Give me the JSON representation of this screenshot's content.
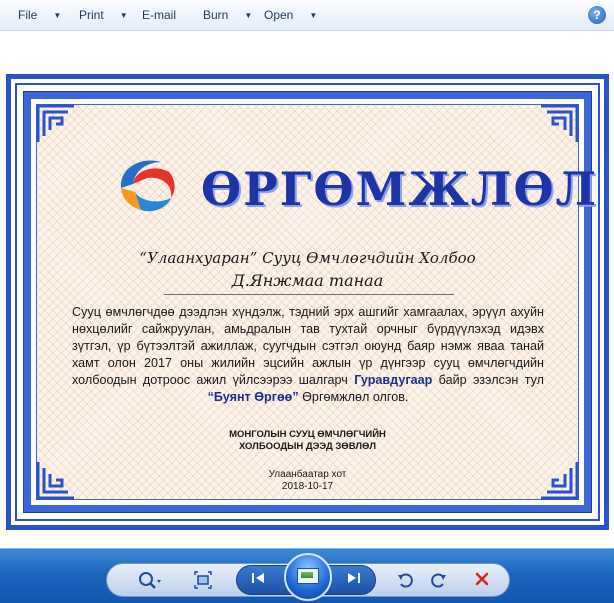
{
  "menu": {
    "file": "File",
    "print": "Print",
    "email": "E-mail",
    "burn": "Burn",
    "open": "Open",
    "help": "?"
  },
  "certificate": {
    "title": "ӨРГӨМЖЛӨЛ",
    "organization": "“Улаанхуаран” Сууц Өмчлөгчдийн Холбоо",
    "recipient": "Д.Янжмаа танаа",
    "body_part1": "Сууц өмчлөгчдөө дээдлэн хүндэлж, тэдний эрх ашгийг хамгаалах, эрүүл ахуйн нөхцөлийг сайжруулан, амьдралын тав тухтай орчныг бүрдүүлэхэд идэвх зүтгэл, үр бүтээлтэй ажиллаж, суугчдын сэтгэл оюунд баяр нэмж яваа танай хамт олон 2017 оны жилийн эцсийн ажлын үр дүнгээр сууц өмчлөгчдийн холбоодын дотроос ажил үйлсээрээ шалгарч",
    "rank": "Гуравдугаар",
    "body_part2": "байр эзэлсэн тул",
    "award_name": "“Буянт Өргөө”",
    "body_part3": "Өргөмжлөл олгов.",
    "council_line1": "МОНГОЛЫН СУУЦ ӨМЧЛӨГЧИЙН",
    "council_line2": "ХОЛБООДЫН ДЭЭД ЗӨВЛӨЛ",
    "place": "Улаанбаатар хот",
    "date": "2018-10-17"
  },
  "colors": {
    "frame_blue": "#2b53c9",
    "title_blue": "#1d34a6",
    "toolbar_blue": "#1b65bf"
  },
  "controls": [
    {
      "name": "zoom",
      "icon": "magnifier-icon"
    },
    {
      "name": "actual-size",
      "icon": "fit-window-icon"
    },
    {
      "name": "previous",
      "icon": "previous-icon"
    },
    {
      "name": "slideshow",
      "icon": "slideshow-icon"
    },
    {
      "name": "next",
      "icon": "next-icon"
    },
    {
      "name": "rotate-counterclockwise",
      "icon": "rotate-ccw-icon"
    },
    {
      "name": "rotate-clockwise",
      "icon": "rotate-cw-icon"
    },
    {
      "name": "delete",
      "icon": "delete-icon"
    }
  ]
}
